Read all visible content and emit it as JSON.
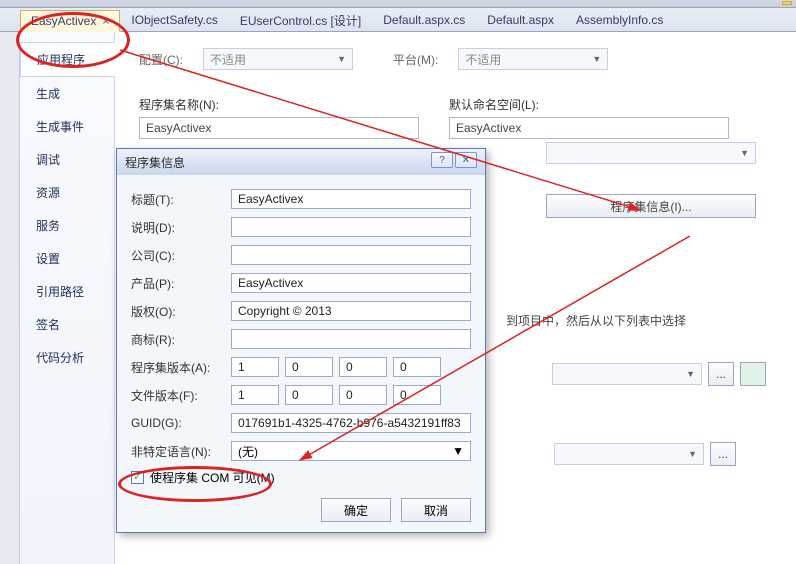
{
  "tabs": [
    {
      "label": "EasyActivex",
      "active": true
    },
    {
      "label": "IObjectSafety.cs"
    },
    {
      "label": "EUserControl.cs [设计]"
    },
    {
      "label": "Default.aspx.cs"
    },
    {
      "label": "Default.aspx"
    },
    {
      "label": "AssemblyInfo.cs"
    }
  ],
  "sidenav": {
    "items": [
      "应用程序",
      "生成",
      "生成事件",
      "调试",
      "资源",
      "服务",
      "设置",
      "引用路径",
      "签名",
      "代码分析"
    ],
    "active_index": 0
  },
  "main": {
    "config_label": "配置(C):",
    "config_value": "不适用",
    "platform_label": "平台(M):",
    "platform_value": "不适用",
    "assembly_name_label": "程序集名称(N):",
    "assembly_name_value": "EasyActivex",
    "default_ns_label": "默认命名空间(L):",
    "default_ns_value": "EasyActivex",
    "assembly_info_btn": "程序集信息(I)...",
    "help_text": "到项目中，然后从以下列表中选择"
  },
  "dialog": {
    "title": "程序集信息",
    "fields": {
      "title_label": "标题(T):",
      "title_value": "EasyActivex",
      "desc_label": "说明(D):",
      "desc_value": "",
      "company_label": "公司(C):",
      "company_value": "",
      "product_label": "产品(P):",
      "product_value": "EasyActivex",
      "copyright_label": "版权(O):",
      "copyright_value": "Copyright ©  2013",
      "trademark_label": "商标(R):",
      "trademark_value": "",
      "asmver_label": "程序集版本(A):",
      "asmver": [
        "1",
        "0",
        "0",
        "0"
      ],
      "filever_label": "文件版本(F):",
      "filever": [
        "1",
        "0",
        "0",
        "0"
      ],
      "guid_label": "GUID(G):",
      "guid_value": "017691b1-4325-4762-b976-a5432191ff83",
      "lang_label": "非特定语言(N):",
      "lang_value": "(无)",
      "com_visible_label": "使程序集 COM 可见(M)",
      "com_visible_checked": true
    },
    "ok": "确定",
    "cancel": "取消"
  }
}
